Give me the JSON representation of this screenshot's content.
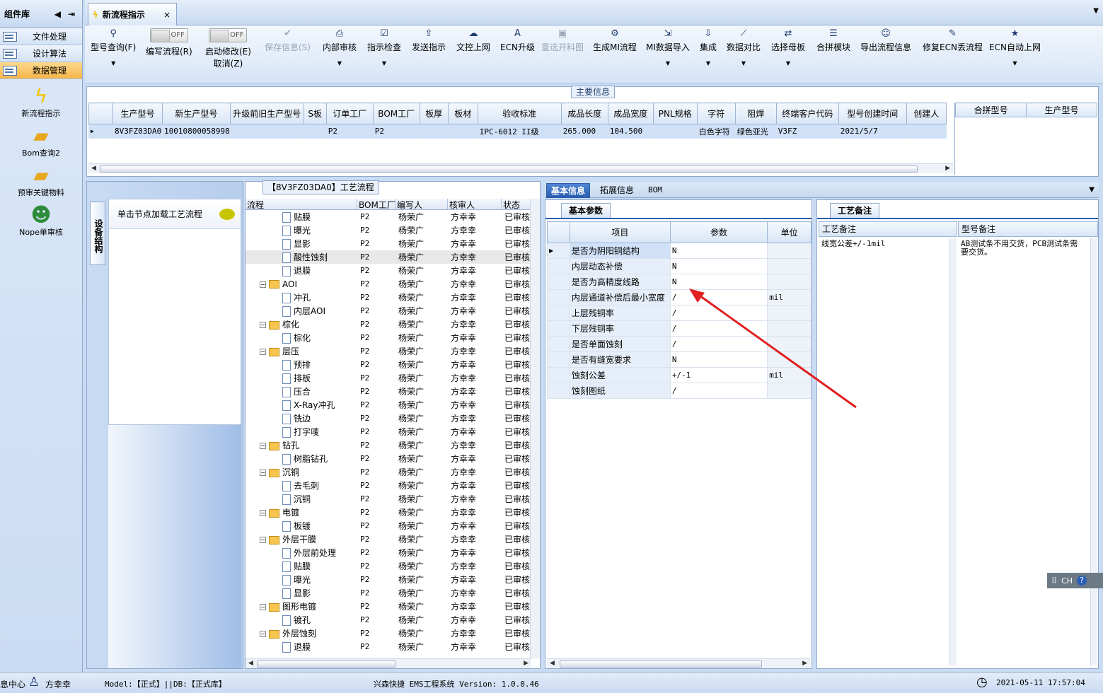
{
  "sidebar": {
    "title": "组件库",
    "categories": [
      {
        "label": "文件处理"
      },
      {
        "label": "设计算法"
      },
      {
        "label": "数据管理",
        "active": true
      }
    ],
    "items": [
      {
        "label": "新流程指示",
        "icon": "lightning-icon"
      },
      {
        "label": "Bom查询2",
        "icon": "folder-open-icon"
      },
      {
        "label": "预审关键物料",
        "icon": "folder-open-icon"
      },
      {
        "label": "Nope单审核",
        "icon": "user-icon"
      }
    ]
  },
  "document_tab": {
    "title": "新流程指示",
    "close": "×"
  },
  "toolbar": {
    "query": "型号查询(F)",
    "edit_flow": "编写流程(R)",
    "edit_flow_toggle": "OFF",
    "start_modify": "启动修改(E)",
    "start_modify_toggle": "OFF",
    "cancel": "取消(Z)",
    "save_info": "保存信息(S)",
    "internal_review": "内部审核",
    "instruction_check": "指示检查",
    "send_instruction": "发送指示",
    "doc_upload": "文控上网",
    "ecn_upgrade": "ECN升级",
    "reselect_image": "重选开料图",
    "gen_mi_flow": "生成MI流程",
    "mi_import": "MI数据导入",
    "integrate": "集成",
    "data_compare": "数据对比",
    "select_master": "选择母板",
    "merge_module": "合拼模块",
    "export_flow": "导出流程信息",
    "repair_ecn": "修复ECN丢流程",
    "ecn_auto_upload": "ECN自动上网"
  },
  "main_info": {
    "title": "主要信息",
    "columns": [
      "生产型号",
      "新生产型号",
      "升级前旧生产型号",
      "S板",
      "订单工厂",
      "BOM工厂",
      "板厚",
      "板材",
      "验收标准",
      "成品长度",
      "成品宽度",
      "PNL规格",
      "字符",
      "阻焊",
      "终端客户代码",
      "型号创建时间",
      "创建人"
    ],
    "row": [
      "8V3FZ03DA0",
      "10010800058998",
      "",
      "",
      "P2",
      "P2",
      "",
      "",
      "IPC-6012 II级",
      "265.000",
      "104.500",
      "",
      "白色字符",
      "绿色亚光",
      "V3FZ",
      "2021/5/7",
      ""
    ],
    "merge_columns": [
      "合拼型号",
      "生产型号"
    ]
  },
  "struct_panel": {
    "tab_label": "设备结构",
    "hint": "单击节点加载工艺流程"
  },
  "process_flow": {
    "title": "【8V3FZ03DA0】工艺流程",
    "columns": [
      "流程",
      "BOM工厂",
      "编写人",
      "核审人",
      "状态"
    ],
    "rows": [
      {
        "name": "贴膜",
        "level": 2,
        "type": "leaf",
        "bom": "P2",
        "author": "杨荣广",
        "reviewer": "方幸幸",
        "status": "已审核"
      },
      {
        "name": "曝光",
        "level": 2,
        "type": "leaf",
        "bom": "P2",
        "author": "杨荣广",
        "reviewer": "方幸幸",
        "status": "已审核"
      },
      {
        "name": "显影",
        "level": 2,
        "type": "leaf",
        "bom": "P2",
        "author": "杨荣广",
        "reviewer": "方幸幸",
        "status": "已审核"
      },
      {
        "name": "酸性蚀刻",
        "level": 2,
        "type": "leaf",
        "bom": "P2",
        "author": "杨荣广",
        "reviewer": "方幸幸",
        "status": "已审核",
        "selected": true
      },
      {
        "name": "退膜",
        "level": 2,
        "type": "leaf",
        "bom": "P2",
        "author": "杨荣广",
        "reviewer": "方幸幸",
        "status": "已审核"
      },
      {
        "name": "AOI",
        "level": 1,
        "type": "folder",
        "bom": "P2",
        "author": "杨荣广",
        "reviewer": "方幸幸",
        "status": "已审核"
      },
      {
        "name": "冲孔",
        "level": 2,
        "type": "leaf",
        "bom": "P2",
        "author": "杨荣广",
        "reviewer": "方幸幸",
        "status": "已审核"
      },
      {
        "name": "内层AOI",
        "level": 2,
        "type": "leaf",
        "bom": "P2",
        "author": "杨荣广",
        "reviewer": "方幸幸",
        "status": "已审核"
      },
      {
        "name": "棕化",
        "level": 1,
        "type": "folder",
        "bom": "P2",
        "author": "杨荣广",
        "reviewer": "方幸幸",
        "status": "已审核"
      },
      {
        "name": "棕化",
        "level": 2,
        "type": "leaf",
        "bom": "P2",
        "author": "杨荣广",
        "reviewer": "方幸幸",
        "status": "已审核"
      },
      {
        "name": "层压",
        "level": 1,
        "type": "folder",
        "bom": "P2",
        "author": "杨荣广",
        "reviewer": "方幸幸",
        "status": "已审核"
      },
      {
        "name": "预排",
        "level": 2,
        "type": "leaf",
        "bom": "P2",
        "author": "杨荣广",
        "reviewer": "方幸幸",
        "status": "已审核"
      },
      {
        "name": "排板",
        "level": 2,
        "type": "leaf",
        "bom": "P2",
        "author": "杨荣广",
        "reviewer": "方幸幸",
        "status": "已审核"
      },
      {
        "name": "压合",
        "level": 2,
        "type": "leaf",
        "bom": "P2",
        "author": "杨荣广",
        "reviewer": "方幸幸",
        "status": "已审核"
      },
      {
        "name": "X-Ray冲孔",
        "level": 2,
        "type": "leaf",
        "bom": "P2",
        "author": "杨荣广",
        "reviewer": "方幸幸",
        "status": "已审核"
      },
      {
        "name": "铣边",
        "level": 2,
        "type": "leaf",
        "bom": "P2",
        "author": "杨荣广",
        "reviewer": "方幸幸",
        "status": "已审核"
      },
      {
        "name": "打字唛",
        "level": 2,
        "type": "leaf",
        "bom": "P2",
        "author": "杨荣广",
        "reviewer": "方幸幸",
        "status": "已审核"
      },
      {
        "name": "钻孔",
        "level": 1,
        "type": "folder",
        "bom": "P2",
        "author": "杨荣广",
        "reviewer": "方幸幸",
        "status": "已审核"
      },
      {
        "name": "树脂钻孔",
        "level": 2,
        "type": "leaf",
        "bom": "P2",
        "author": "杨荣广",
        "reviewer": "方幸幸",
        "status": "已审核"
      },
      {
        "name": "沉铜",
        "level": 1,
        "type": "folder",
        "bom": "P2",
        "author": "杨荣广",
        "reviewer": "方幸幸",
        "status": "已审核"
      },
      {
        "name": "去毛刺",
        "level": 2,
        "type": "leaf",
        "bom": "P2",
        "author": "杨荣广",
        "reviewer": "方幸幸",
        "status": "已审核"
      },
      {
        "name": "沉铜",
        "level": 2,
        "type": "leaf",
        "bom": "P2",
        "author": "杨荣广",
        "reviewer": "方幸幸",
        "status": "已审核"
      },
      {
        "name": "电镀",
        "level": 1,
        "type": "folder",
        "bom": "P2",
        "author": "杨荣广",
        "reviewer": "方幸幸",
        "status": "已审核"
      },
      {
        "name": "板镀",
        "level": 2,
        "type": "leaf",
        "bom": "P2",
        "author": "杨荣广",
        "reviewer": "方幸幸",
        "status": "已审核"
      },
      {
        "name": "外层干膜",
        "level": 1,
        "type": "folder",
        "bom": "P2",
        "author": "杨荣广",
        "reviewer": "方幸幸",
        "status": "已审核"
      },
      {
        "name": "外层前处理",
        "level": 2,
        "type": "leaf",
        "bom": "P2",
        "author": "杨荣广",
        "reviewer": "方幸幸",
        "status": "已审核"
      },
      {
        "name": "贴膜",
        "level": 2,
        "type": "leaf",
        "bom": "P2",
        "author": "杨荣广",
        "reviewer": "方幸幸",
        "status": "已审核"
      },
      {
        "name": "曝光",
        "level": 2,
        "type": "leaf",
        "bom": "P2",
        "author": "杨荣广",
        "reviewer": "方幸幸",
        "status": "已审核"
      },
      {
        "name": "显影",
        "level": 2,
        "type": "leaf",
        "bom": "P2",
        "author": "杨荣广",
        "reviewer": "方幸幸",
        "status": "已审核"
      },
      {
        "name": "图形电镀",
        "level": 1,
        "type": "folder",
        "bom": "P2",
        "author": "杨荣广",
        "reviewer": "方幸幸",
        "status": "已审核"
      },
      {
        "name": "镀孔",
        "level": 2,
        "type": "leaf",
        "bom": "P2",
        "author": "杨荣广",
        "reviewer": "方幸幸",
        "status": "已审核"
      },
      {
        "name": "外层蚀刻",
        "level": 1,
        "type": "folder",
        "bom": "P2",
        "author": "杨荣广",
        "reviewer": "方幸幸",
        "status": "已审核"
      },
      {
        "name": "退膜",
        "level": 2,
        "type": "leaf",
        "bom": "P2",
        "author": "杨荣广",
        "reviewer": "方幸幸",
        "status": "已审核"
      }
    ]
  },
  "info_tabs": [
    "基本信息",
    "拓展信息",
    "BOM"
  ],
  "basic_params": {
    "section": "基本参数",
    "columns": [
      "项目",
      "参数",
      "单位"
    ],
    "rows": [
      {
        "item": "是否为阴阳铜结构",
        "value": "N",
        "unit": ""
      },
      {
        "item": "内层动态补偿",
        "value": "N",
        "unit": ""
      },
      {
        "item": "是否为高精度线路",
        "value": "N",
        "unit": ""
      },
      {
        "item": "内层通道补偿后最小宽度",
        "value": "/",
        "unit": "mil"
      },
      {
        "item": "上层残铜率",
        "value": "/",
        "unit": ""
      },
      {
        "item": "下层残铜率",
        "value": "/",
        "unit": ""
      },
      {
        "item": "是否单面蚀刻",
        "value": "/",
        "unit": ""
      },
      {
        "item": "是否有缝宽要求",
        "value": "N",
        "unit": ""
      },
      {
        "item": "蚀刻公差",
        "value": "+/-1",
        "unit": "mil"
      },
      {
        "item": "蚀刻图纸",
        "value": "/",
        "unit": ""
      }
    ]
  },
  "process_note": {
    "section": "工艺备注",
    "columns": [
      "工艺备注",
      "型号备注"
    ],
    "process_remark": "线宽公差+/-1mil",
    "model_remark": "AB测试条不用交货，PCB测试条需要交货。"
  },
  "statusbar": {
    "left": "息中心",
    "user": "方幸幸",
    "model": "Model:【正式】||DB:【正式库】",
    "system": "兴森快捷 EMS工程系统 Version: 1.0.0.46",
    "datetime": "2021-05-11 17:57:04"
  },
  "ime": {
    "label": "CH"
  },
  "colors": {
    "accent": "#2a5cb0",
    "annotation_arrow": "#e02020",
    "active_category": "#f7b54a"
  }
}
